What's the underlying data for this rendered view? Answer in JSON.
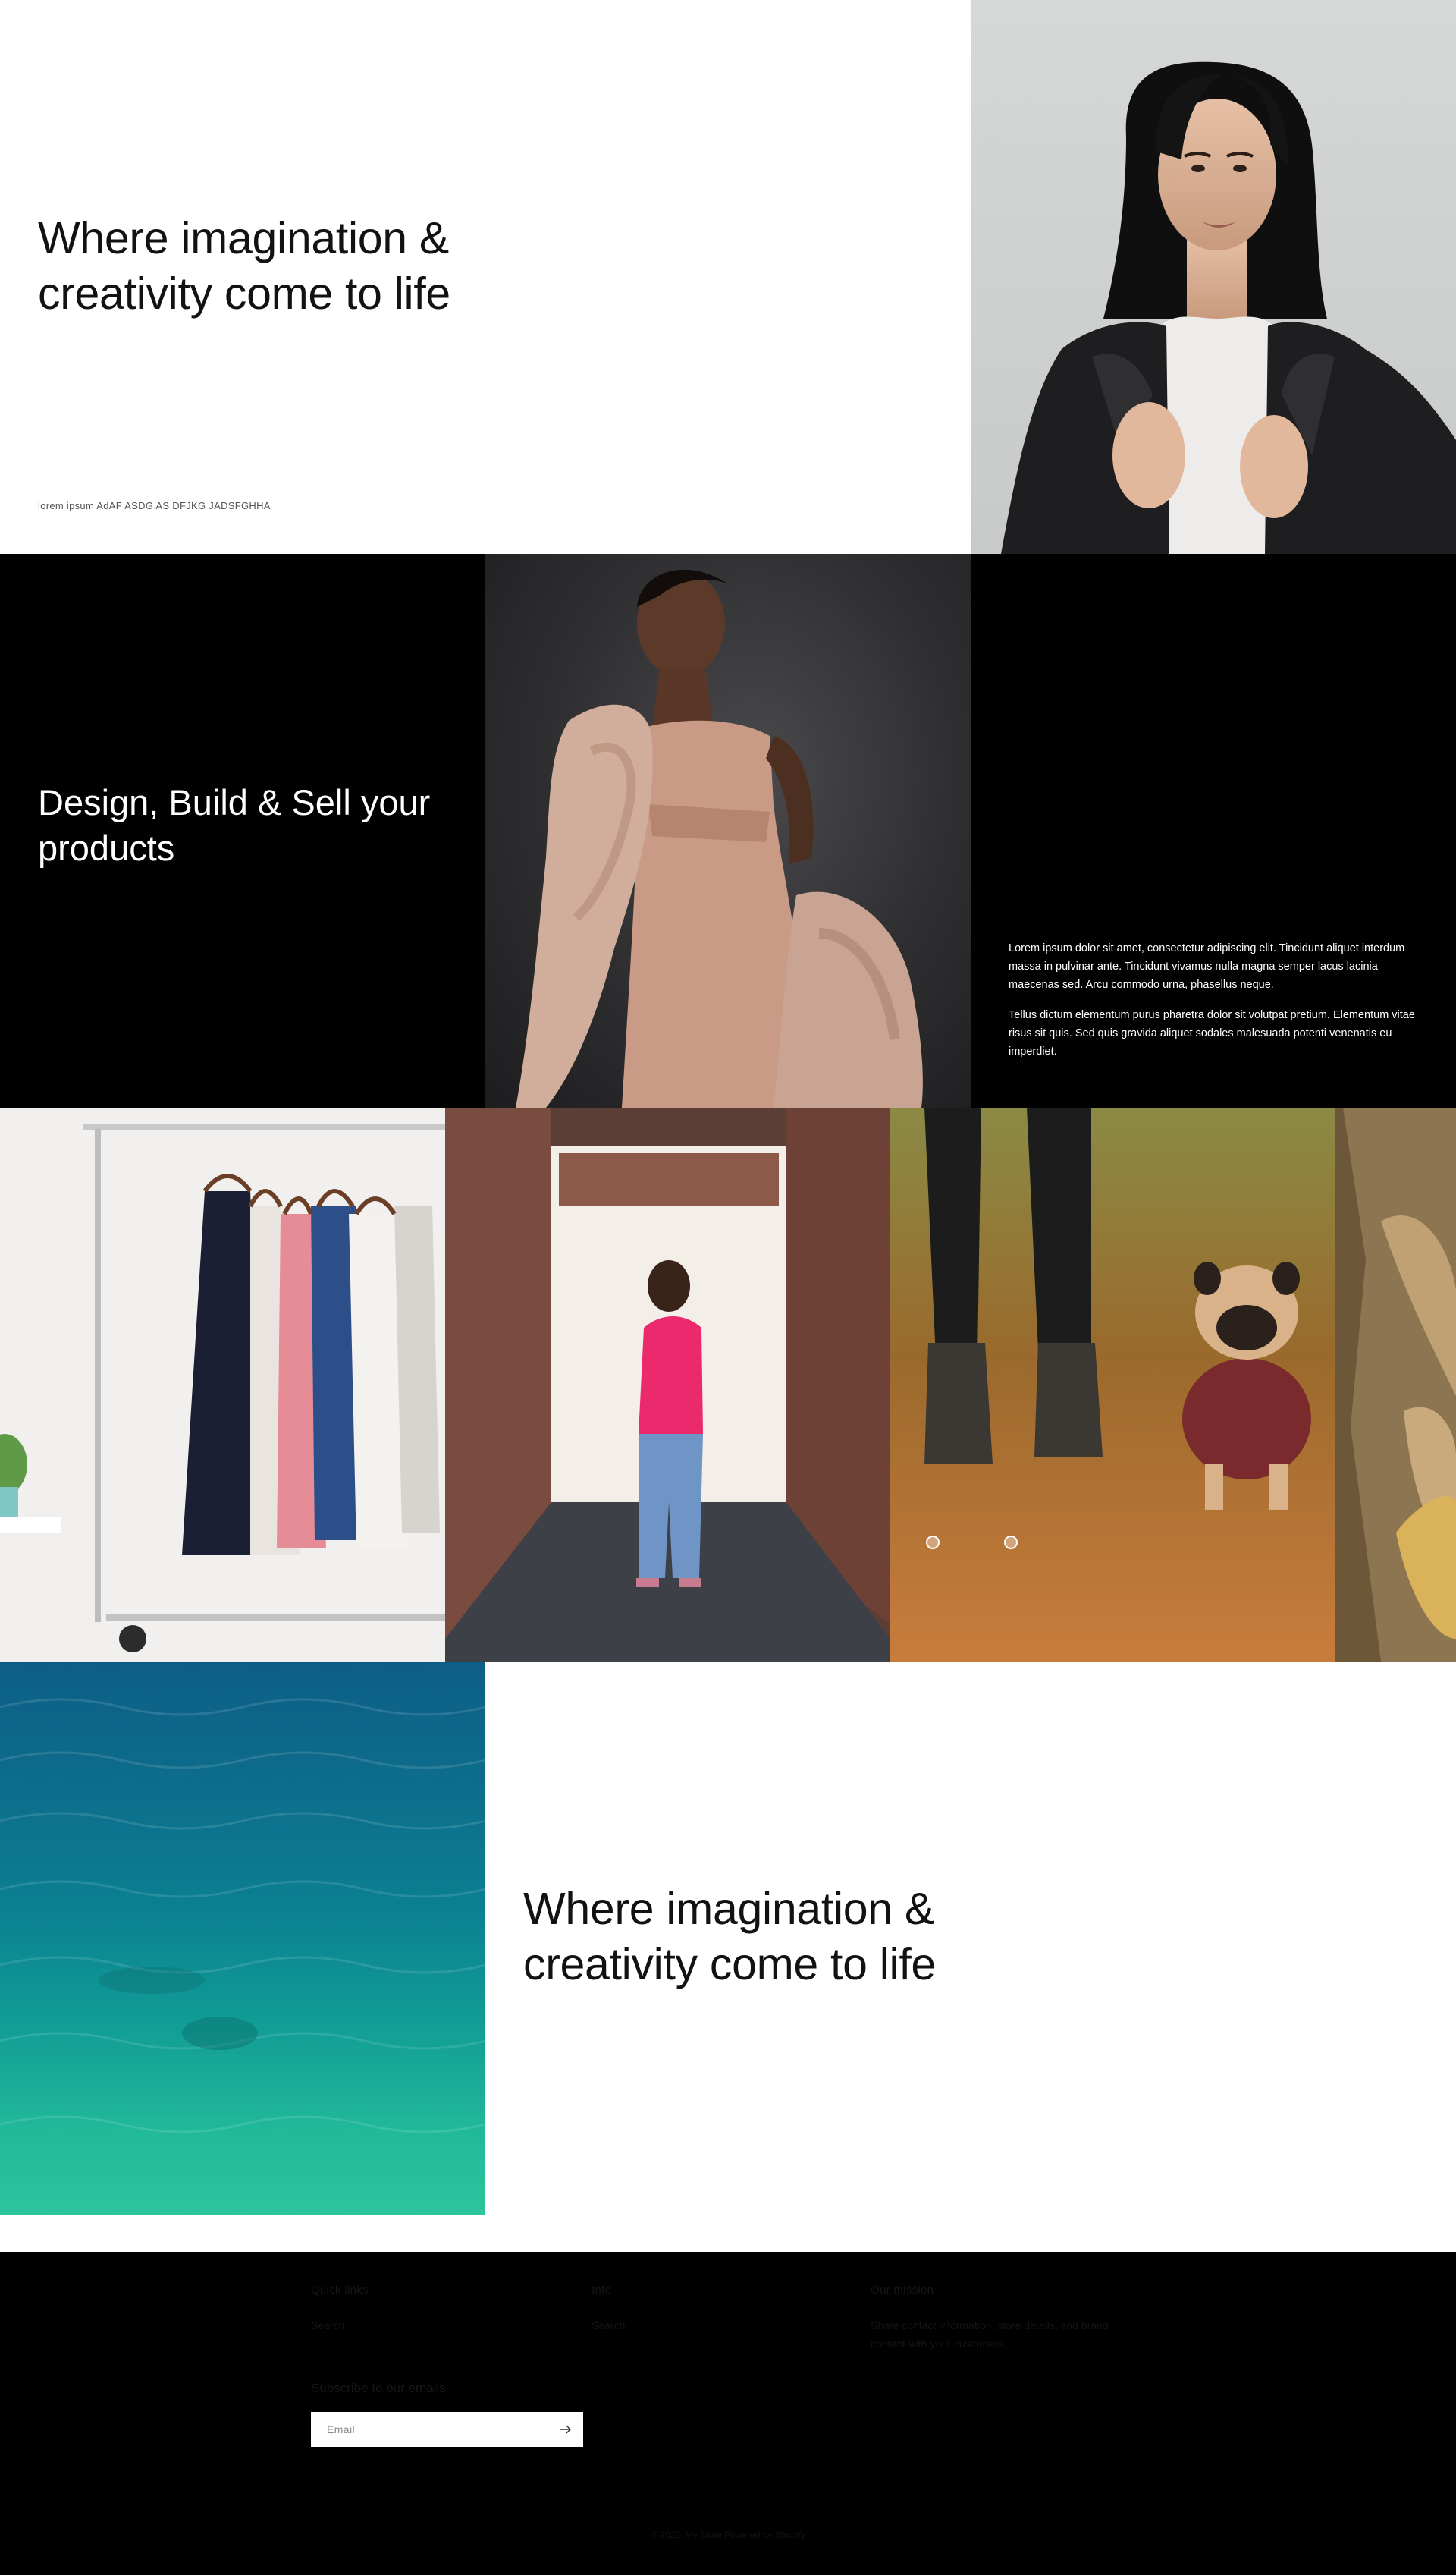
{
  "hero": {
    "title": "Where imagination & creativity come to life",
    "caption": "lorem ipsum AdAF ASDG AS DFJKG JADSFGHHA"
  },
  "feature": {
    "title": "Design, Build & Sell your products",
    "paragraphs": [
      "Lorem ipsum dolor sit amet, consectetur adipiscing elit. Tincidunt aliquet interdum massa in pulvinar ante. Tincidunt vivamus nulla magna semper lacus lacinia maecenas sed. Arcu commodo urna, phasellus neque.",
      "Tellus dictum elementum purus pharetra dolor sit volutpat pretium. Elementum vitae risus sit quis. Sed quis gravida aliquet sodales malesuada potenti venenatis eu imperdiet."
    ]
  },
  "banner": {
    "title": "Where imagination & creativity come to life"
  },
  "footer": {
    "columns": [
      {
        "heading": "Quick links",
        "link": "Search"
      },
      {
        "heading": "Info",
        "link": "Search"
      },
      {
        "heading": "Our mission",
        "text": "Share contact information, store details, and brand content with your customers."
      }
    ],
    "subscribe_heading": "Subscribe to our emails",
    "email_placeholder": "Email",
    "copyright": "© 2022, My Store Powered by Shopify"
  },
  "colors": {
    "dark_background": "#000000",
    "light_background": "#ffffff",
    "text": "#121212"
  },
  "icons": [
    "arrow-right-icon"
  ]
}
